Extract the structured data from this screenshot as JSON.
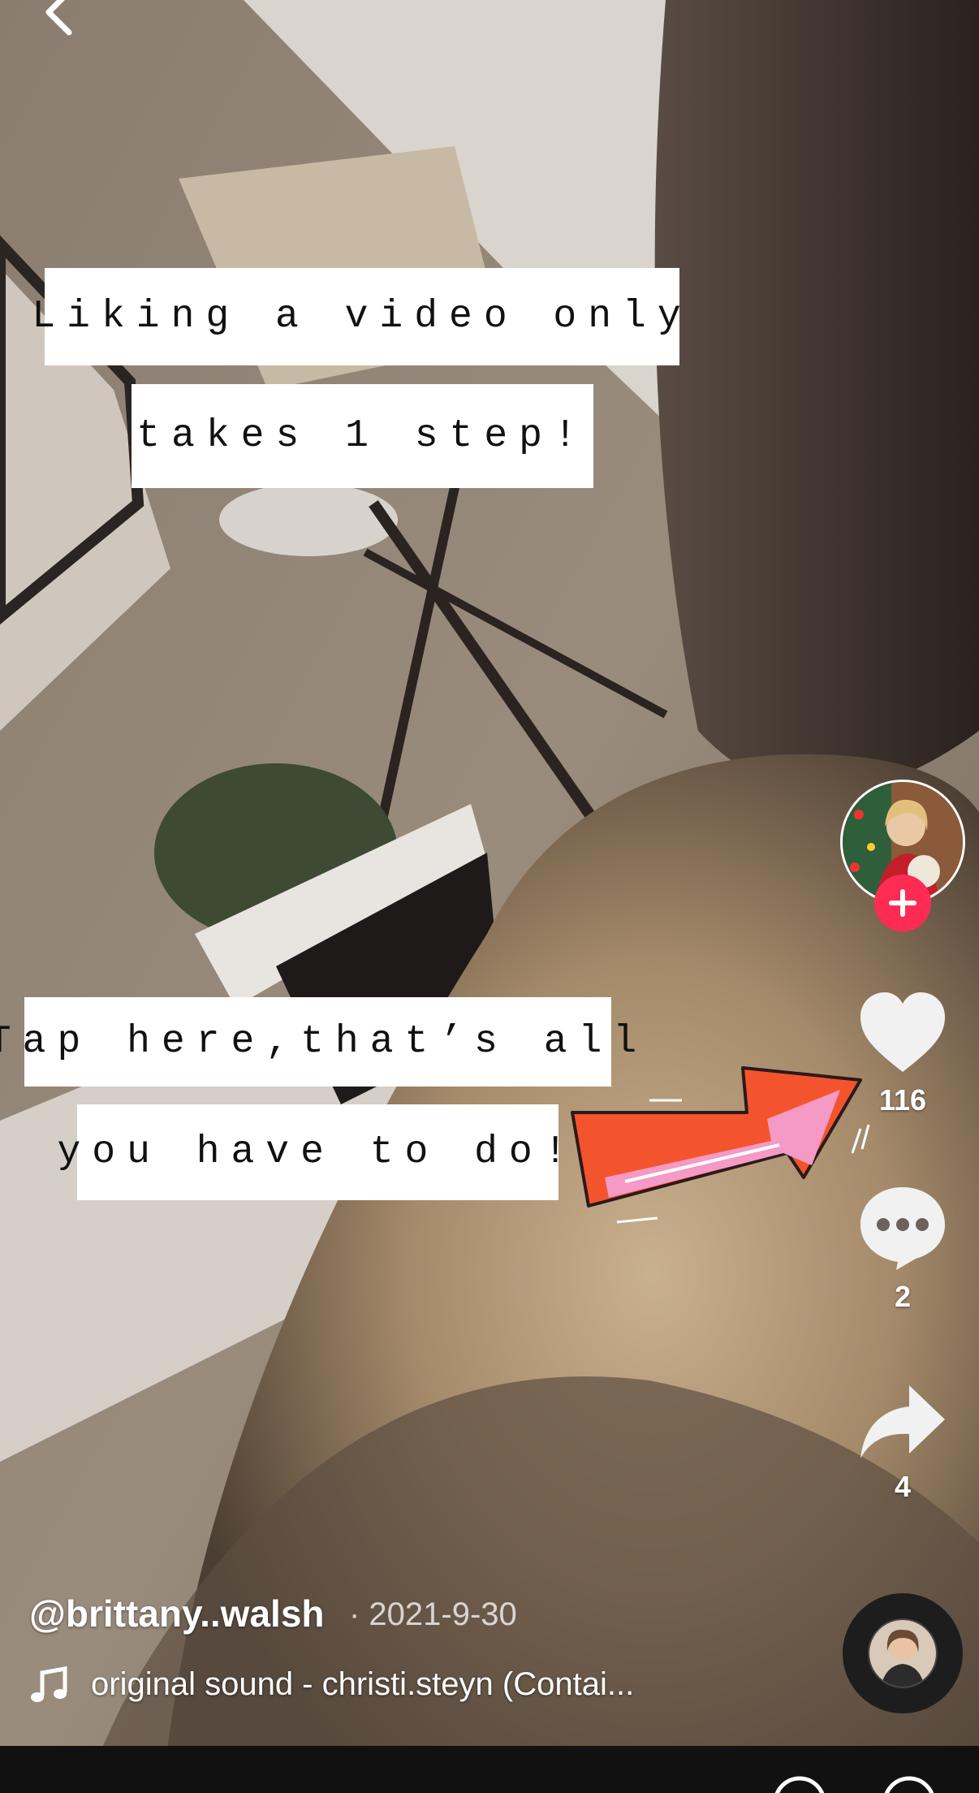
{
  "captions": {
    "top_line1": "Liking a video only",
    "top_line2": "takes 1 step!",
    "mid_line1": "Tap here,that’s all",
    "mid_line2": "you have to do!"
  },
  "actions": {
    "likes": "116",
    "comments": "2",
    "shares": "4"
  },
  "post": {
    "username": "@brittany..walsh",
    "date": "· 2021-9-30",
    "sound": "original sound - christi.steyn (Contai..."
  },
  "icons": [
    "back-icon",
    "heart-icon",
    "comment-icon",
    "share-icon",
    "music-note-icon",
    "plus-icon",
    "music-disc"
  ],
  "colors": {
    "follow": "#fe2c55",
    "arrow_outer": "#f4542d",
    "arrow_inner": "#f49ac4"
  }
}
